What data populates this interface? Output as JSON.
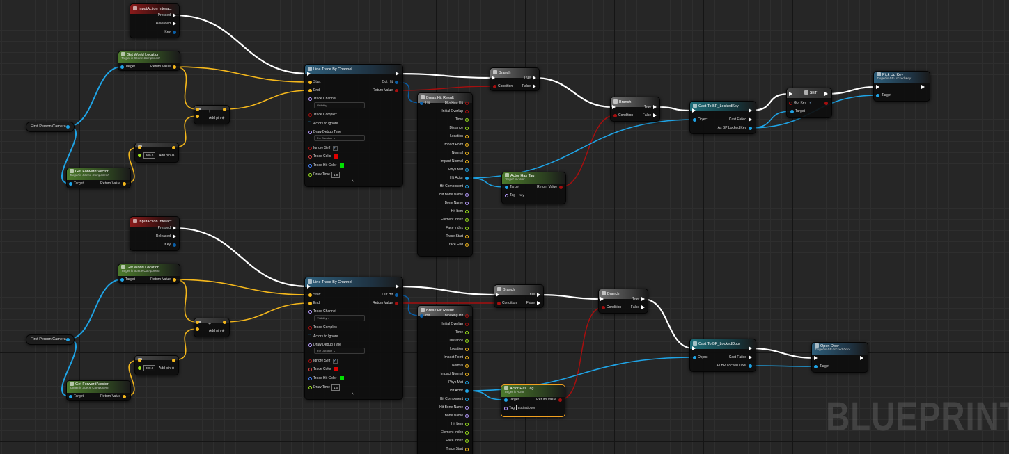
{
  "watermark": "BLUEPRINT",
  "colors": {
    "exec": "#ffffff",
    "object": "#1fa4e6",
    "vector": "#f5b81c",
    "float": "#9be31c",
    "bool": "#a50f0f",
    "struct": "#0a5fa8",
    "name": "#b79cff"
  },
  "input_action": {
    "title": "InputAction Interact",
    "pressed": "Pressed",
    "released": "Released",
    "key": "Key"
  },
  "camera": {
    "label": "First Person Camera"
  },
  "get_world_location": {
    "title": "Get World Location",
    "subtitle": "Target is Scene Component",
    "target": "Target",
    "return_value": "Return Value"
  },
  "get_forward_vector": {
    "title": "Get Forward Vector",
    "subtitle": "Target is Scene Component",
    "target": "Target",
    "return_value": "Return Value"
  },
  "multiply": {
    "value": "300.0",
    "add_pin": "Add pin"
  },
  "add": {
    "add_pin": "Add pin"
  },
  "line_trace": {
    "title": "Line Trace By Channel",
    "start": "Start",
    "end": "End",
    "out_hit": "Out Hit",
    "return_value": "Return Value",
    "trace_channel": "Trace Channel",
    "trace_channel_value": "Visibility",
    "trace_complex": "Trace Complex",
    "actors_to_ignore": "Actors to Ignore",
    "draw_debug_type": "Draw Debug Type",
    "draw_debug_value": "For Duration",
    "ignore_self": "Ignore Self",
    "trace_color": "Trace Color",
    "trace_hit_color": "Trace Hit Color",
    "draw_time": "Draw Time",
    "draw_time_value": "1.0"
  },
  "break_hit": {
    "title": "Break Hit Result",
    "hit": "Hit",
    "outputs": [
      "Blocking Hit",
      "Initial Overlap",
      "Time",
      "Distance",
      "Location",
      "Impact Point",
      "Normal",
      "Impact Normal",
      "Phys Mat",
      "Hit Actor",
      "Hit Component",
      "Hit Bone Name",
      "Bone Name",
      "Hit Item",
      "Element Index",
      "Face Index",
      "Trace Start",
      "Trace End"
    ]
  },
  "branch": {
    "title": "Branch",
    "condition": "Condition",
    "true": "True",
    "false": "False"
  },
  "actor_has_tag": {
    "title": "Actor Has Tag",
    "subtitle": "Target is Actor",
    "target": "Target",
    "tag": "Tag",
    "return_value": "Return Value",
    "tag_top": "Key",
    "tag_bottom": "LockedDoor"
  },
  "cast_key": {
    "title": "Cast To BP_LockedKey",
    "object": "Object",
    "cast_failed": "Cast Failed",
    "as_out": "As BP Locked Key"
  },
  "cast_door": {
    "title": "Cast To BP_LockedDoor",
    "object": "Object",
    "cast_failed": "Cast Failed",
    "as_out": "As BP Locked Door"
  },
  "set_node": {
    "title": "SET",
    "got_key": "Got Key"
  },
  "pick_up_key": {
    "title": "Pick Up Key",
    "subtitle": "Target is BP Locked Key",
    "target": "Target"
  },
  "open_door": {
    "title": "Open Door",
    "subtitle": "Target is BP Locked Door",
    "target": "Target"
  }
}
